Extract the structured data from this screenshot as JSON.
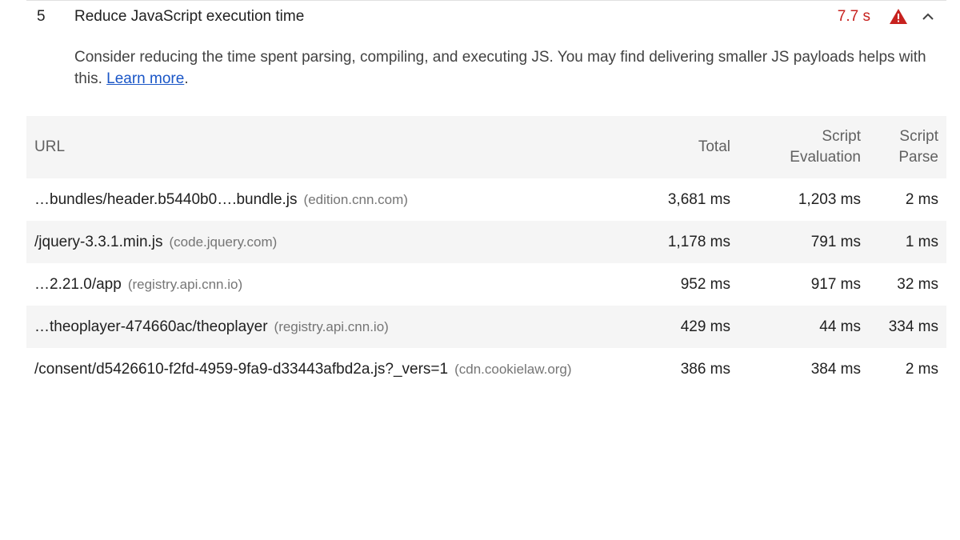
{
  "audit": {
    "index": "5",
    "title": "Reduce JavaScript execution time",
    "display_value": "7.7 s",
    "status": "fail",
    "status_icon": "warning-triangle-icon",
    "expand_icon": "chevron-up-icon",
    "colors": {
      "fail": "#c7221f",
      "link": "#1a56c7",
      "row_stripe": "#f5f5f5"
    },
    "description": "Consider reducing the time spent parsing, compiling, and executing JS. You may find delivering smaller JS payloads helps with this.",
    "learn_more": "Learn more",
    "description_end": "."
  },
  "table": {
    "headers": {
      "url": "URL",
      "total": "Total",
      "script_eval_line1": "Script",
      "script_eval_line2": "Evaluation",
      "script_parse_line1": "Script",
      "script_parse_line2": "Parse"
    },
    "rows": [
      {
        "url": "…bundles/header.b5440b0….bundle.js",
        "host": "(edition.cnn.com)",
        "total": "3,681 ms",
        "eval": "1,203 ms",
        "parse": "2 ms"
      },
      {
        "url": "/jquery-3.3.1.min.js",
        "host": "(code.jquery.com)",
        "total": "1,178 ms",
        "eval": "791 ms",
        "parse": "1 ms"
      },
      {
        "url": "…2.21.0/app",
        "host": "(registry.api.cnn.io)",
        "total": "952 ms",
        "eval": "917 ms",
        "parse": "32 ms"
      },
      {
        "url": "…theoplayer-474660ac/theoplayer",
        "host": "(registry.api.cnn.io)",
        "total": "429 ms",
        "eval": "44 ms",
        "parse": "334 ms"
      },
      {
        "url": "/consent/d5426610-f2fd-4959-9fa9-d33443afbd2a.js?_vers=1",
        "host": "(cdn.cookielaw.org)",
        "total": "386 ms",
        "eval": "384 ms",
        "parse": "2 ms"
      }
    ]
  }
}
